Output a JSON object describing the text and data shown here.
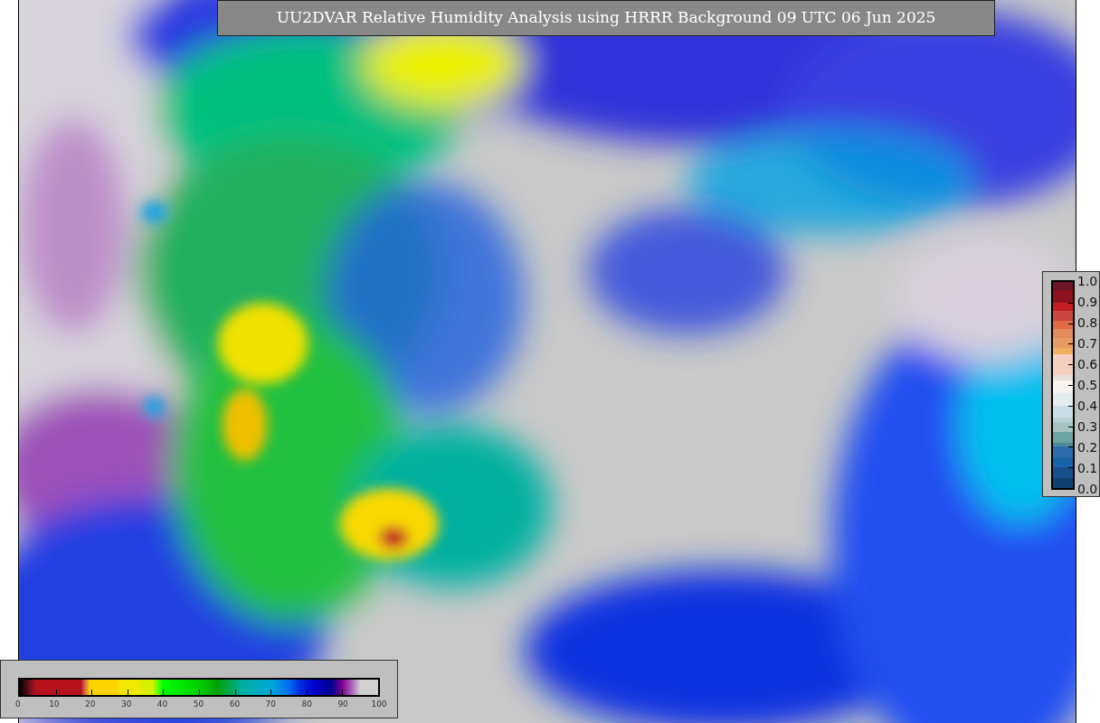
{
  "title": "UU2DVAR Relative Humidity Analysis using HRRR Background 09 UTC 06 Jun 2025",
  "humidity_scale": {
    "ticks": [
      "0",
      "10",
      "20",
      "30",
      "40",
      "50",
      "60",
      "70",
      "80",
      "90",
      "100"
    ]
  },
  "ratio_scale": {
    "ticks": [
      "1.0",
      "0.9",
      "0.8",
      "0.7",
      "0.6",
      "0.5",
      "0.4",
      "0.3",
      "0.2",
      "0.1",
      "0.0"
    ]
  }
}
